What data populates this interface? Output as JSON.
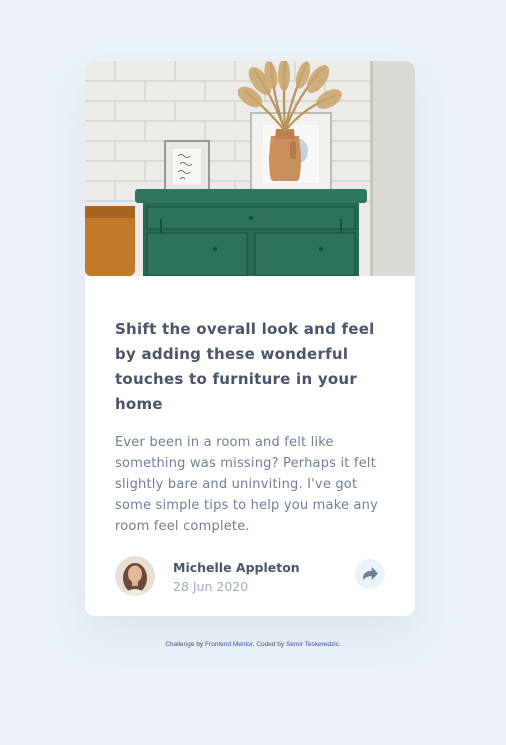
{
  "card": {
    "image_alt": "drawers",
    "title": "Shift the overall look and feel by adding these wonderful touches to furniture in your home",
    "excerpt": "Ever been in a room and felt like something was missing? Perhaps it felt slightly bare and uninviting. I've got some simple tips to help you make any room feel complete.",
    "author": {
      "name": "Michelle Appleton",
      "date": "28 Jun 2020"
    },
    "share_icon": "share-icon"
  },
  "attribution": {
    "prefix": "Challenge by",
    "challenge_link": "Frontend Mentor",
    "middle": ". Coded by",
    "author_link": "Semir Teskeredzic",
    "suffix": "."
  },
  "colors": {
    "background": "#ecf2f8",
    "title": "#48556a",
    "body_text": "#6e8098",
    "date": "#9eafc2",
    "drawer_green": "#2c6e5a"
  }
}
